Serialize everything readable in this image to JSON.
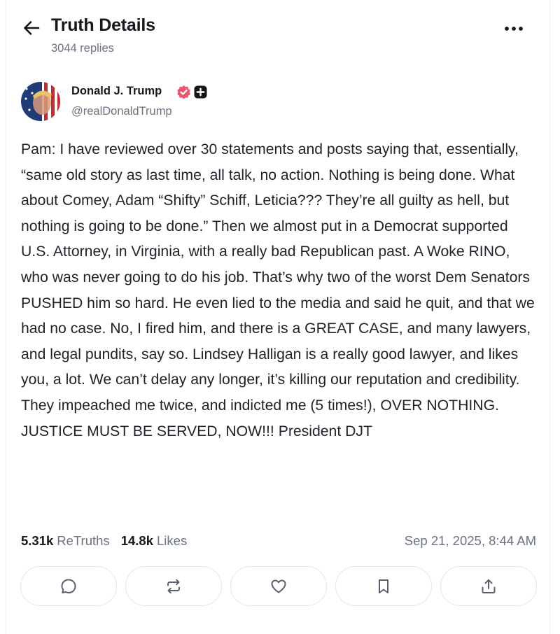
{
  "header": {
    "title": "Truth Details",
    "reply_count": "3044 replies",
    "back_icon": "arrow-left-icon",
    "more_icon": "more-horizontal-icon"
  },
  "author": {
    "name": "Donald J. Trump",
    "handle": "@realDonaldTrump",
    "verified_color": "#e8566c"
  },
  "post": {
    "text": "Pam: I have reviewed over 30 statements and posts saying that, essentially, “same old story as last time, all talk, no action. Nothing is being done. What about Comey, Adam “Shifty” Schiff, Leticia??? They’re all guilty as hell, but nothing is going to be done.” Then we almost put in a Democrat supported U.S. Attorney, in Virginia, with a really bad Republican past. A Woke RINO, who was never going to do his job. That’s why two of the worst Dem Senators PUSHED him so hard. He even lied to the media and said he quit, and that we had no case. No, I fired him, and there is a GREAT CASE, and many lawyers, and legal pundits, say so. Lindsey Halligan is a really good lawyer, and likes you, a lot. We can’t delay any longer, it’s killing our reputation and credibility. They impeached me twice, and indicted me (5 times!), OVER NOTHING. JUSTICE MUST BE SERVED, NOW!!! President DJT"
  },
  "stats": {
    "retruths_count": "5.31k",
    "retruths_label": "ReTruths",
    "likes_count": "14.8k",
    "likes_label": "Likes",
    "timestamp": "Sep 21, 2025, 8:44 AM"
  },
  "actions": [
    {
      "icon": "reply-icon"
    },
    {
      "icon": "retruth-icon"
    },
    {
      "icon": "like-icon"
    },
    {
      "icon": "bookmark-icon"
    },
    {
      "icon": "share-icon"
    }
  ]
}
